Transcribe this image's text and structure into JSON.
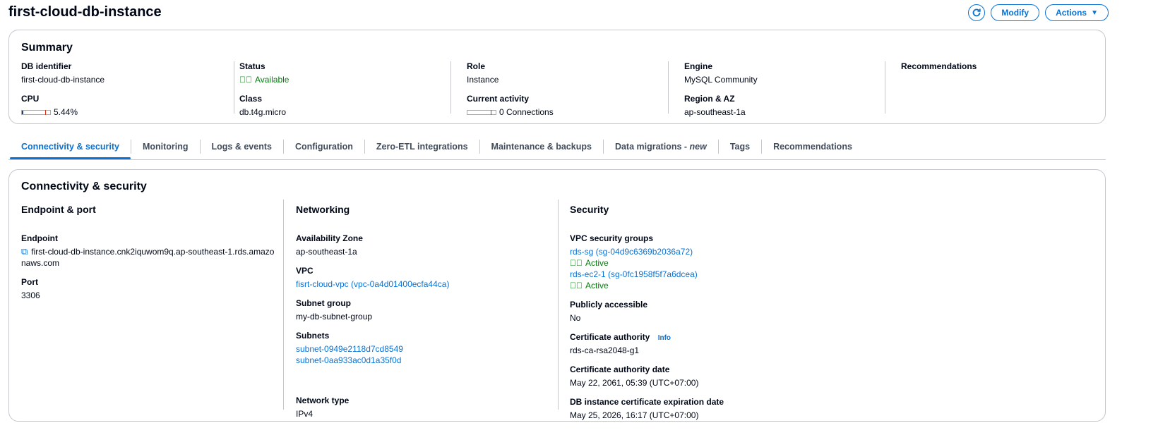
{
  "header": {
    "title": "first-cloud-db-instance",
    "modify": "Modify",
    "actions": "Actions"
  },
  "summary": {
    "title": "Summary",
    "db_identifier_label": "DB identifier",
    "db_identifier": "first-cloud-db-instance",
    "cpu_label": "CPU",
    "cpu": "5.44%",
    "cpu_fraction": 0.0544,
    "status_label": "Status",
    "status": "Available",
    "class_label": "Class",
    "class": "db.t4g.micro",
    "role_label": "Role",
    "role": "Instance",
    "activity_label": "Current activity",
    "activity": "0 Connections",
    "engine_label": "Engine",
    "engine": "MySQL Community",
    "region_label": "Region & AZ",
    "region": "ap-southeast-1a",
    "recommendations_label": "Recommendations"
  },
  "tabs": [
    "Connectivity & security",
    "Monitoring",
    "Logs & events",
    "Configuration",
    "Zero-ETL integrations",
    "Maintenance & backups",
    "Data migrations - ",
    "Tags",
    "Recommendations"
  ],
  "tab_new": "new",
  "conn": {
    "title": "Connectivity & security",
    "endpoint_port": {
      "title": "Endpoint & port",
      "endpoint_label": "Endpoint",
      "endpoint": "first-cloud-db-instance.cnk2iquwom9q.ap-southeast-1.rds.amazonaws.com",
      "port_label": "Port",
      "port": "3306"
    },
    "networking": {
      "title": "Networking",
      "az_label": "Availability Zone",
      "az": "ap-southeast-1a",
      "vpc_label": "VPC",
      "vpc": "fisrt-cloud-vpc (vpc-0a4d01400ecfa44ca)",
      "subnet_group_label": "Subnet group",
      "subnet_group": "my-db-subnet-group",
      "subnets_label": "Subnets",
      "subnets": [
        "subnet-0949e2118d7cd8549",
        "subnet-0aa933ac0d1a35f0d"
      ],
      "network_type_label": "Network type",
      "network_type": "IPv4"
    },
    "security": {
      "title": "Security",
      "sg_label": "VPC security groups",
      "sg": [
        {
          "name": "rds-sg (sg-04d9c6369b2036a72)",
          "status": "Active"
        },
        {
          "name": "rds-ec2-1 (sg-0fc1958f5f7a6dcea)",
          "status": "Active"
        }
      ],
      "public_label": "Publicly accessible",
      "public": "No",
      "ca_label": "Certificate authority",
      "info": "Info",
      "ca": "rds-ca-rsa2048-g1",
      "ca_date_label": "Certificate authority date",
      "ca_date": "May 22, 2061, 05:39 (UTC+07:00)",
      "exp_label": "DB instance certificate expiration date",
      "exp": "May 25, 2026, 16:17 (UTC+07:00)"
    }
  }
}
